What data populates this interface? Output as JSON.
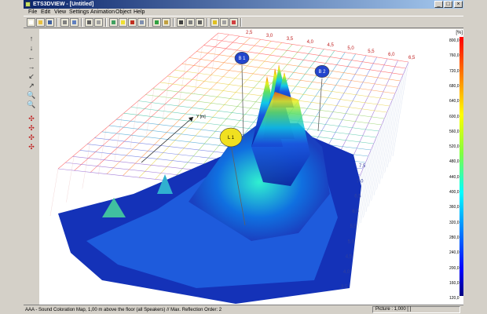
{
  "window": {
    "title": "ETS3DVIEW - [Untitled]",
    "controls": [
      "_",
      "□",
      "×"
    ]
  },
  "menu": [
    "File",
    "Edit",
    "View",
    "Settings",
    "Animation",
    "Object",
    "Help"
  ],
  "toolbar_icons": [
    {
      "name": "new-file-icon",
      "color": "#ffffff"
    },
    {
      "name": "open-folder-icon",
      "color": "#e8c040"
    },
    {
      "name": "save-icon",
      "color": "#4060a0"
    },
    {
      "name": "copy-icon",
      "color": "#808080"
    },
    {
      "name": "export-icon",
      "color": "#6080c0"
    },
    {
      "name": "print-icon",
      "color": "#606060"
    },
    {
      "name": "print-preview-icon",
      "color": "#a0a0a0"
    },
    {
      "name": "room-view-icon",
      "color": "#40a060"
    },
    {
      "name": "light-bulb-icon",
      "color": "#f0e030"
    },
    {
      "name": "speaker-red-icon",
      "color": "#c03020"
    },
    {
      "name": "cube-icon",
      "color": "#8090b0"
    },
    {
      "name": "chart-icon",
      "color": "#30a040"
    },
    {
      "name": "map-icon",
      "color": "#c0a040"
    },
    {
      "name": "image-icon",
      "color": "#404040"
    },
    {
      "name": "camera-icon",
      "color": "#808080"
    },
    {
      "name": "animate-icon",
      "color": "#606060"
    },
    {
      "name": "help-icon",
      "color": "#e0c020"
    },
    {
      "name": "wrench-icon",
      "color": "#a0a0a0"
    },
    {
      "name": "color-icon",
      "color": "#d04040"
    }
  ],
  "left_tools": [
    {
      "name": "pan-up-icon",
      "glyph": "↑"
    },
    {
      "name": "pan-down-icon",
      "glyph": "↓"
    },
    {
      "name": "pan-left-icon",
      "glyph": "←"
    },
    {
      "name": "pan-right-icon",
      "glyph": "→"
    },
    {
      "name": "rotate-left-icon",
      "glyph": "↙"
    },
    {
      "name": "rotate-right-icon",
      "glyph": "↗"
    },
    {
      "name": "zoom-in-icon",
      "glyph": "🔍"
    },
    {
      "name": "zoom-out-icon",
      "glyph": "🔍"
    },
    {
      "name": "move-tool-red-1-icon",
      "glyph": "✣"
    },
    {
      "name": "move-tool-red-2-icon",
      "glyph": "✣"
    },
    {
      "name": "move-tool-red-3-icon",
      "glyph": "✣"
    },
    {
      "name": "move-tool-red-4-icon",
      "glyph": "✣"
    }
  ],
  "plot": {
    "axis_label_y": "Y [m]",
    "x_ticks": [
      "2,5",
      "3,0",
      "3,5",
      "4,0",
      "4,5",
      "5,0",
      "5,5",
      "6,0",
      "6,5"
    ],
    "y_ticks": [
      "7,5",
      "7,0",
      "6,5",
      "6,0",
      "5,5",
      "5,0",
      "4,5",
      "4,0",
      "3,5"
    ],
    "markers": [
      {
        "label": "B 1",
        "color": "#2244cc"
      },
      {
        "label": "B 2",
        "color": "#2244cc"
      },
      {
        "label": "L 1",
        "color": "#f0e020"
      }
    ]
  },
  "scale": {
    "unit": "[%]",
    "ticks": [
      "800,0",
      "760,0",
      "720,0",
      "680,0",
      "640,0",
      "600,0",
      "560,0",
      "520,0",
      "480,0",
      "440,0",
      "400,0",
      "360,0",
      "320,0",
      "280,0",
      "240,0",
      "200,0",
      "160,0",
      "120,0"
    ],
    "colors": [
      "#ff0000",
      "#ff8000",
      "#ffff00",
      "#80ff40",
      "#00ffff",
      "#0080ff",
      "#0000ff",
      "#000080"
    ]
  },
  "status": {
    "left": "AAA - Sound Coloration Map, 1,00 m above the floor (all Speakers) // Max. Reflection Order: 2",
    "right": "Picture : 1,000 [ ]"
  }
}
